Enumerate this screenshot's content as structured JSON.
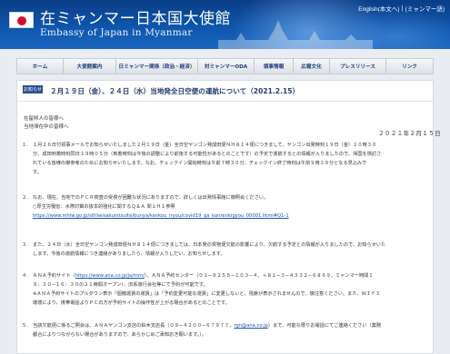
{
  "header": {
    "title_ja": "在ミャンマー日本国大使館",
    "title_en": "Embassy of Japan in Myanmar",
    "lang_english": "English(本文へ)",
    "lang_separator": "|",
    "lang_myanmar": "(ミャンマー語)"
  },
  "nav": {
    "items": [
      "ホーム",
      "大使館案内",
      "日ミャンマー関係（政治・経済）",
      "対ミャンマーODA",
      "領事情報",
      "広報文化",
      "プレスリリース",
      "リンク"
    ]
  },
  "notice": {
    "badge": "お知らせ",
    "title": "２月１９日（金）、２４日（水）当地発全日空便の運航について（2021.2.15）",
    "greeting_1": "在留邦人の皆様へ",
    "greeting_2": "当地滞在中の皆様へ",
    "date": "２０２１年２月１５日",
    "paragraphs": [
      {
        "num": "１.",
        "lines": [
          "１月２６日付領事メールでお知らせいたしました２月１９日（金）全日空ヤンゴン発成田便ＮＨ８１４便につきまして、ヤンゴン出発時刻１９日（金）１０時３０",
          "分、成田到着時刻同日１９時０５分（到着時刻は今後の調整により前後する可能性があるとのことです）の予定で運航するとの情報が入りましたので、帰国を検討さ",
          "れている皆様の御参考のためにお知らせいたします。なお、チェックイン開始時刻は午前７時３０分、チェックイン終了時刻は午前９時３０分となる見込みで",
          "す。"
        ]
      },
      {
        "num": "２.",
        "lines": [
          "なお、現在、当地でのＰＣＲ検査の受検が困難な状況にありますので、詳しくは出発情事館に御照会ください。",
          "○厚生労働省：水際対策の抜本的強化に関するＱ＆Ａ 問１Ｈ１参照"
        ],
        "link": "https://www.mhlw.go.jp/stf/seisakunitsuite/bunya/kenkou_iryou/covid19_qa_kanrenkigyou_00001.html#Q1-1"
      },
      {
        "num": "３.",
        "lines": [
          "また、２４日（水）全日空ヤンゴン発成田便ＮＨ８１４便につきましては、日本発の貨物便欠航の影響により、欠航する予定との情報が入りましたので、お知らせいた",
          "します。今後の運航情報につき連絡がありましたら、情報が入りしだい、お知らせします。"
        ]
      },
      {
        "num": "４.",
        "lines_with_link": {
          "before": "ＡＮＡ予約サイト（",
          "link": "https://www.ana.co.jp/ja/mm/",
          "after": "）、ＡＮＡ予約センター（０１−９２５５−１０３−４、＋８１−３−４３３２−６８６９、ミャンマー時間１"
        },
        "lines": [
          "９：３０−１６：３０の２１時間オープン）、旧系旅行会社等にて予約が可能です。",
          "※ＡＮＡ予約サイトのプルダウン表示「個機運賃の運賃」は「予約変更可能な運賃」に変更しないと、残席が表示されませんので、御注意ください。また、ＷＩＦＩ",
          "環境により、携帯電話よりＰＣの方が予約サイトの操作性が上がる場合があるとのことです。"
        ]
      },
      {
        "num": "５.",
        "lines_with_link": {
          "before": "当該欠航便に係るご照会は、ＡＮＡヤンゴン支店の鈴木支店長（０９−４２００−６７９７７、",
          "link": "rgn@ana.co.jp",
          "after": "）まで、可能な限りお電話にてご連絡ください（業務"
        },
        "lines": [
          "都合によりつながらない場合がありますので、あらかじめご承知おき願います。）。"
        ]
      }
    ]
  }
}
